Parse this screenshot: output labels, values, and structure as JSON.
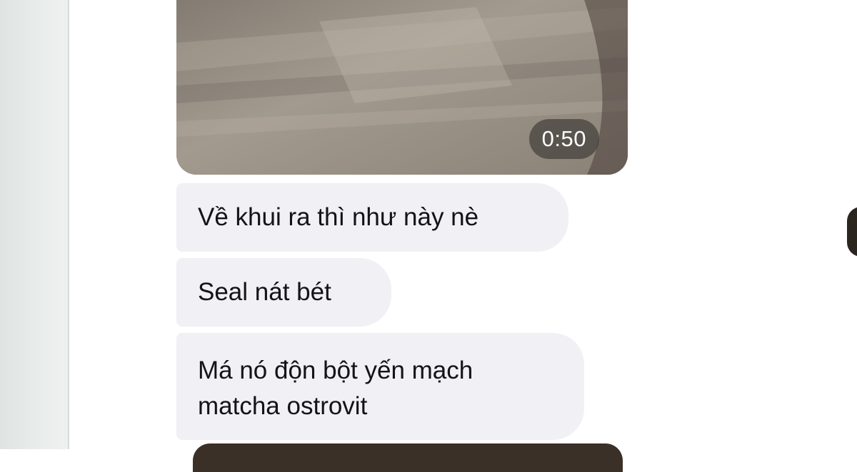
{
  "video": {
    "duration": "0:50",
    "icon": "video-thumbnail"
  },
  "messages": [
    {
      "text": "Về khui ra thì như này nè"
    },
    {
      "text": "Seal nát bét"
    },
    {
      "lines": [
        "Má nó độn bột yến mạch",
        "matcha ostrovit"
      ]
    }
  ],
  "colors": {
    "bubble": "#f0f0f5",
    "text": "#141414",
    "background": "#ffffff"
  }
}
